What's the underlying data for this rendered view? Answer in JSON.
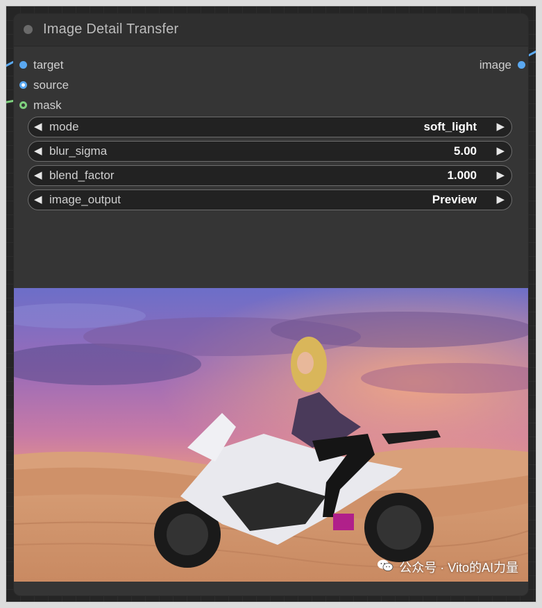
{
  "node": {
    "title": "Image Detail Transfer",
    "inputs": [
      {
        "label": "target",
        "color": "#5aa8f0"
      },
      {
        "label": "source",
        "color": "#5aa8f0"
      },
      {
        "label": "mask",
        "color": "#7ed07e"
      }
    ],
    "outputs": [
      {
        "label": "image",
        "color": "#5aa8f0"
      }
    ],
    "widgets": [
      {
        "name": "mode",
        "value": "soft_light"
      },
      {
        "name": "blur_sigma",
        "value": "5.00"
      },
      {
        "name": "blend_factor",
        "value": "1.000"
      },
      {
        "name": "image_output",
        "value": "Preview"
      }
    ],
    "arrows": {
      "left": "◀",
      "right": "▶"
    }
  },
  "watermark": {
    "text": "公众号 · Vito的AI力量",
    "icon": "wechat-icon"
  }
}
